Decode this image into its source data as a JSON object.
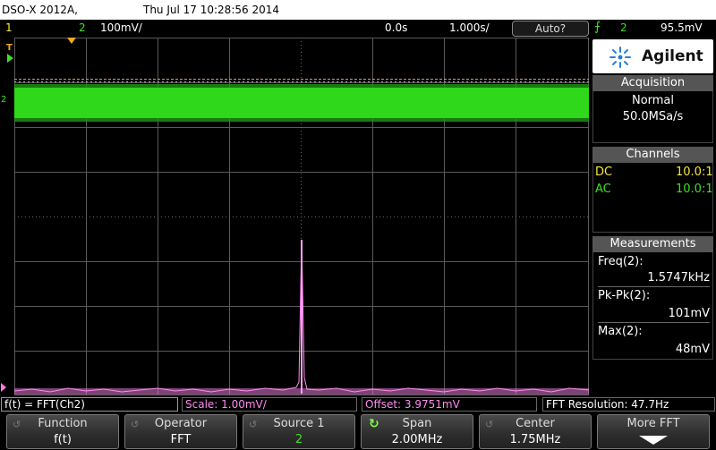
{
  "titlebar": {
    "model": "DSO-X 2012A,",
    "datetime": "Thu Jul 17 10:28:56 2014"
  },
  "status": {
    "ch1_num": "1",
    "ch2_num": "2",
    "ch2_scale": "100mV/",
    "time_offset": "0.0s",
    "time_scale": "1.000s/",
    "run_mode": "Auto?",
    "trigger_icon": "trigger-edge-icon",
    "trigger_source": "2",
    "trigger_level": "95.5mV",
    "colors": {
      "ch1": "#f5e642",
      "ch2": "#40e020",
      "math": "#ff7be6"
    }
  },
  "markers": {
    "trigger_T": "T",
    "ch2_label": "2"
  },
  "panel": {
    "brand": "Agilent",
    "acquisition": {
      "title": "Acquisition",
      "mode": "Normal",
      "rate": "50.0MSa/s"
    },
    "channels": {
      "title": "Channels",
      "rows": [
        {
          "coupling": "DC",
          "probe": "10.0:1"
        },
        {
          "coupling": "AC",
          "probe": "10.0:1"
        }
      ]
    },
    "measurements": {
      "title": "Measurements",
      "items": [
        {
          "label": "Freq(2):",
          "value": "1.5747kHz"
        },
        {
          "label": "Pk-Pk(2):",
          "value": "101mV"
        },
        {
          "label": "Max(2):",
          "value": "48mV"
        }
      ]
    }
  },
  "info": {
    "math": "f(t) = FFT(Ch2)",
    "scale": "Scale: 1.00mV/",
    "offset": "Offset: 3.9751mV",
    "resolution": "FFT Resolution: 47.7Hz"
  },
  "softkeys": [
    {
      "label": "Function",
      "value": "f(t)"
    },
    {
      "label": "Operator",
      "value": "FFT"
    },
    {
      "label": "Source 1",
      "value": "2"
    },
    {
      "label": "Span",
      "value": "2.00MHz"
    },
    {
      "label": "Center",
      "value": "1.75MHz"
    },
    {
      "label": "More FFT",
      "value": ""
    }
  ]
}
